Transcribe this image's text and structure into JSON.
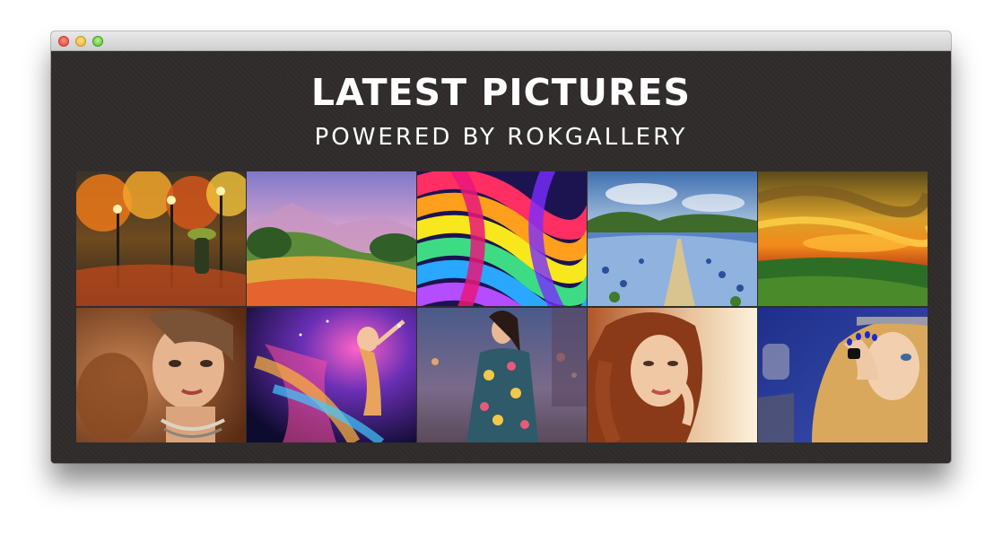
{
  "gallery": {
    "title": "LATEST PICTURES",
    "subtitle": "POWERED BY ROKGALLERY",
    "pictures": [
      {
        "name": "autumn-park-painting",
        "icon": "painting-thumbnail"
      },
      {
        "name": "meadow-hills-painting",
        "icon": "painting-thumbnail"
      },
      {
        "name": "rainbow-ribbons-art",
        "icon": "abstract-thumbnail"
      },
      {
        "name": "blue-flower-field-painting",
        "icon": "painting-thumbnail"
      },
      {
        "name": "golden-sunset-painting",
        "icon": "painting-thumbnail"
      },
      {
        "name": "woman-with-jewelry-photo",
        "icon": "portrait-thumbnail"
      },
      {
        "name": "cosmic-dancer-art",
        "icon": "portrait-thumbnail"
      },
      {
        "name": "woman-in-floral-dress-photo",
        "icon": "portrait-thumbnail"
      },
      {
        "name": "red-haired-woman-photo",
        "icon": "portrait-thumbnail"
      },
      {
        "name": "blonde-woman-blue-nails-photo",
        "icon": "portrait-thumbnail"
      }
    ]
  },
  "colors": {
    "background": "#2f2c2b",
    "heading": "#ffffff"
  }
}
